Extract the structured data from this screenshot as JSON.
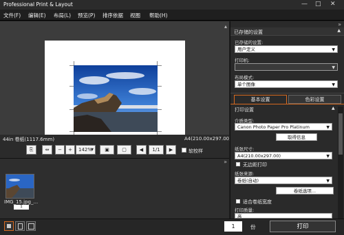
{
  "app": {
    "title": "Professional Print & Layout",
    "minimize": "—",
    "maximize": "□",
    "close": "✕"
  },
  "menu": [
    "文件(F)",
    "编辑(E)",
    "布局(L)",
    "预览(P)",
    "排序依据",
    "视图",
    "帮助(H)"
  ],
  "info": {
    "paper_roll": "44in 卷纸(1117.6mm)",
    "paper_size": "A4(210.00x297.00)"
  },
  "toolbar": {
    "zoom": "142%",
    "page": "1/1",
    "proof_label": "软校样",
    "prev": "◀",
    "next": "▶"
  },
  "thumbnail": {
    "name": "IMG_15.jpg_...",
    "copies": "1"
  },
  "bottom": {
    "copies_value": "1",
    "copies_unit": "份",
    "print_button": "打印"
  },
  "panel": {
    "saved_header": "已存储的设置",
    "saved_label": "已存储的设置:",
    "saved_value": "用户定义",
    "printer_label": "打印机:",
    "printer_value": "",
    "layout_label": "布局模式:",
    "layout_value": "单个图像",
    "tab_basic": "基本设置",
    "tab_color": "色彩设置",
    "print_settings": "打印设置",
    "media_label": "介质类型:",
    "media_value": "Canon Photo Paper Pro Platinum",
    "get_info": "取得信息",
    "paper_size_label": "纸张尺寸:",
    "paper_size_value": "A4(210.00x297.00)",
    "borderless": "无边距打印",
    "source_label": "纸张来源:",
    "source_value": "卷纸(自动)",
    "roll_options": "卷纸选项...",
    "fit_roll": "适合卷纸宽度",
    "quality_label": "打印质量:",
    "quality_value": "高"
  },
  "colors": {
    "accent": "#d86a1f",
    "paper": "#ffffff",
    "sky": "#2460b8"
  }
}
